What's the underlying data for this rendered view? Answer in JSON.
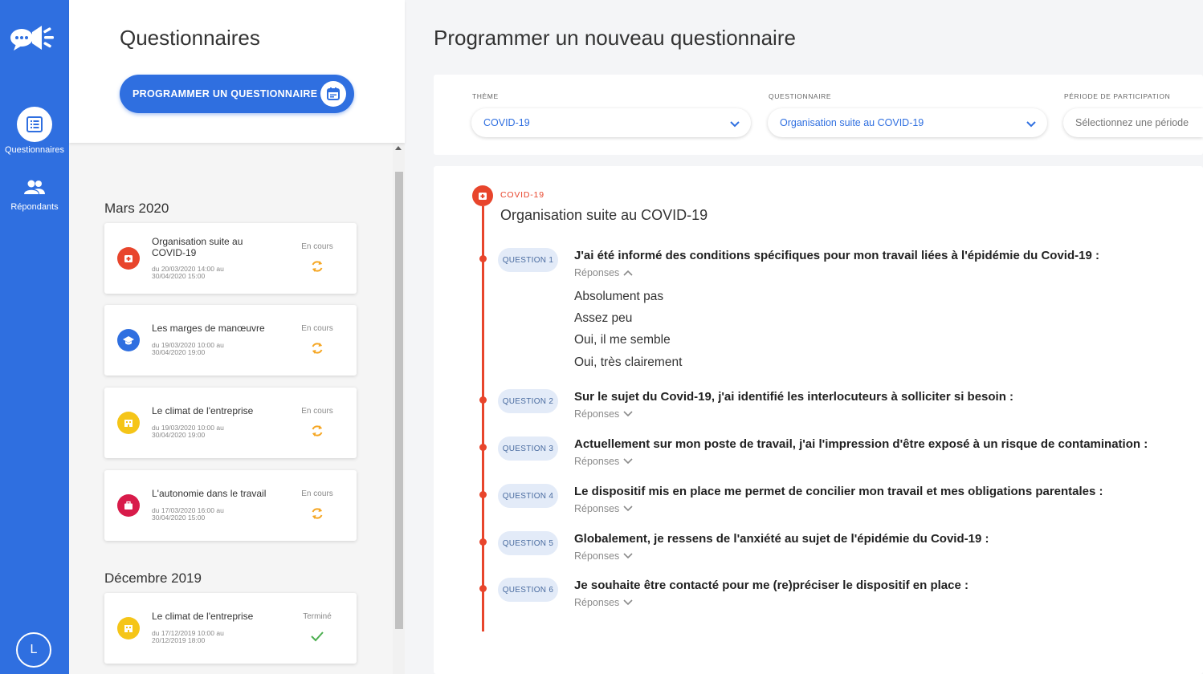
{
  "rail": {
    "nav": [
      {
        "label": "Questionnaires",
        "icon": "list-icon"
      },
      {
        "label": "Répondants",
        "icon": "users-icon"
      }
    ],
    "avatar_letter": "L"
  },
  "panel": {
    "title": "Questionnaires",
    "program_button": "PROGRAMMER UN QUESTIONNAIRE",
    "groups": [
      {
        "month": "Mars 2020",
        "items": [
          {
            "name": "Organisation suite au COVID-19",
            "dates": "du 20/03/2020 14:00 au 30/04/2020 15:00",
            "status": "En cours",
            "icon": "medical-icon",
            "color": "#e8452c"
          },
          {
            "name": "Les marges de manœuvre",
            "dates": "du 19/03/2020 10:00 au 30/04/2020 19:00",
            "status": "En cours",
            "icon": "graduation-cap-icon",
            "color": "#2f6fe0"
          },
          {
            "name": "Le climat de l'entreprise",
            "dates": "du 19/03/2020 10:00 au 30/04/2020 19:00",
            "status": "En cours",
            "icon": "building-icon",
            "color": "#f5c518"
          },
          {
            "name": "L'autonomie dans le travail",
            "dates": "du 17/03/2020 16:00 au 30/04/2020 15:00",
            "status": "En cours",
            "icon": "briefcase-icon",
            "color": "#d81b4a"
          }
        ]
      },
      {
        "month": "Décembre 2019",
        "items": [
          {
            "name": "Le climat de l'entreprise",
            "dates": "du 17/12/2019 10:00 au 20/12/2019 18:00",
            "status": "Terminé",
            "icon": "building-icon",
            "color": "#f5c518"
          }
        ]
      }
    ]
  },
  "main": {
    "title": "Programmer un nouveau questionnaire",
    "filters": {
      "theme_label": "THÈME",
      "theme_value": "COVID-19",
      "questionnaire_label": "QUESTIONNAIRE",
      "questionnaire_value": "Organisation suite au COVID-19",
      "period_label": "PÉRIODE DE PARTICIPATION",
      "period_placeholder": "Sélectionnez une période"
    },
    "detail": {
      "theme": "COVID-19",
      "title": "Organisation suite au COVID-19",
      "responses_label": "Réponses",
      "questions": [
        {
          "tag": "QUESTION 1",
          "text": "J'ai été informé des conditions spécifiques pour mon travail liées à l'épidémie du Covid-19 :",
          "expanded": true,
          "answers": [
            "Absolument pas",
            "Assez peu",
            "Oui, il me semble",
            "Oui, très clairement"
          ]
        },
        {
          "tag": "QUESTION 2",
          "text": "Sur le sujet du Covid-19, j'ai identifié les interlocuteurs à solliciter si besoin :",
          "expanded": false
        },
        {
          "tag": "QUESTION 3",
          "text": "Actuellement sur mon poste de travail, j'ai l'impression d'être exposé à un risque de contamination :",
          "expanded": false
        },
        {
          "tag": "QUESTION 4",
          "text": "Le dispositif mis en place me permet de concilier mon travail et mes obligations parentales :",
          "expanded": false
        },
        {
          "tag": "QUESTION 5",
          "text": "Globalement, je ressens de l'anxiété au sujet de l'épidémie du Covid-19 :",
          "expanded": false
        },
        {
          "tag": "QUESTION 6",
          "text": "Je souhaite être contacté pour me (re)préciser le dispositif en place :",
          "expanded": false
        }
      ]
    }
  },
  "colors": {
    "primary": "#2f6fe0",
    "covid_red": "#e8452c",
    "in_progress": "#f5a623",
    "done": "#4caf50"
  }
}
